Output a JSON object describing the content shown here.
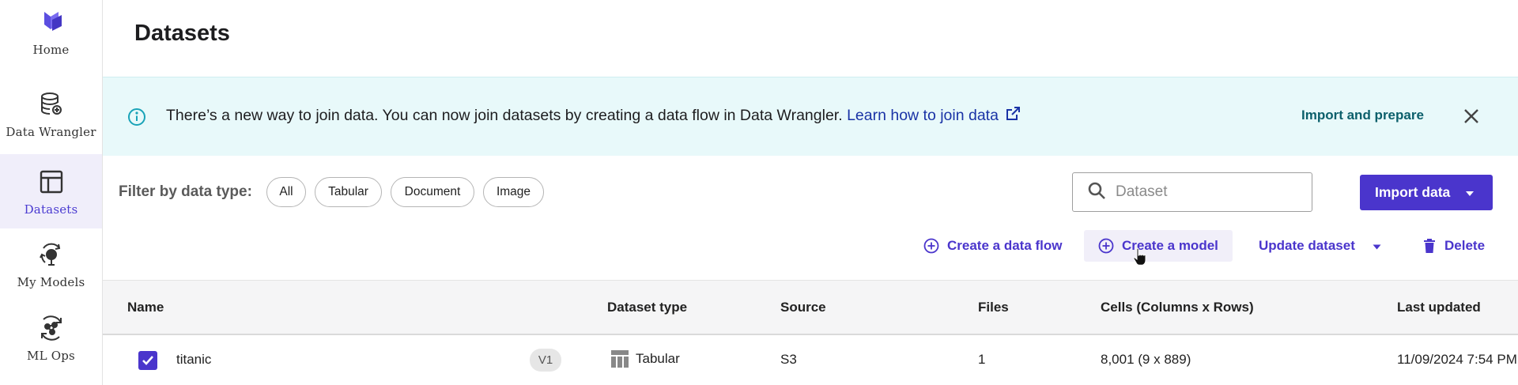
{
  "sidebar": {
    "items": [
      {
        "label": "Home",
        "icon": "logo-icon"
      },
      {
        "label": "Data Wrangler",
        "icon": "database-icon"
      },
      {
        "label": "Datasets",
        "icon": "table-icon",
        "active": true
      },
      {
        "label": "My Models",
        "icon": "model-icon"
      },
      {
        "label": "ML Ops",
        "icon": "mlops-icon"
      }
    ]
  },
  "page": {
    "title": "Datasets"
  },
  "banner": {
    "text": "There’s a new way to join data. You can now join datasets by creating a data flow in Data Wrangler.",
    "link": "Learn how to join data",
    "action": "Import and prepare"
  },
  "filter": {
    "label": "Filter by data type:",
    "chips": [
      "All",
      "Tabular",
      "Document",
      "Image"
    ]
  },
  "search": {
    "placeholder": "Dataset"
  },
  "import_button": {
    "label": "Import data"
  },
  "actions": {
    "create_flow": "Create a data flow",
    "create_model": "Create a model",
    "update_dataset": "Update dataset",
    "delete": "Delete"
  },
  "table": {
    "columns": [
      "Name",
      "Dataset type",
      "Source",
      "Files",
      "Cells (Columns x Rows)",
      "Last updated"
    ],
    "rows": [
      {
        "checked": true,
        "name": "titanic",
        "version": "V1",
        "type": "Tabular",
        "source": "S3",
        "files": "1",
        "cells": "8,001 (9 x 889)",
        "last_updated": "11/09/2024 7:54 PM"
      }
    ]
  },
  "colors": {
    "accent": "#4a35cc",
    "banner_bg": "#e8f9fa",
    "banner_action": "#0b5f6b",
    "link": "#1a33a6"
  }
}
